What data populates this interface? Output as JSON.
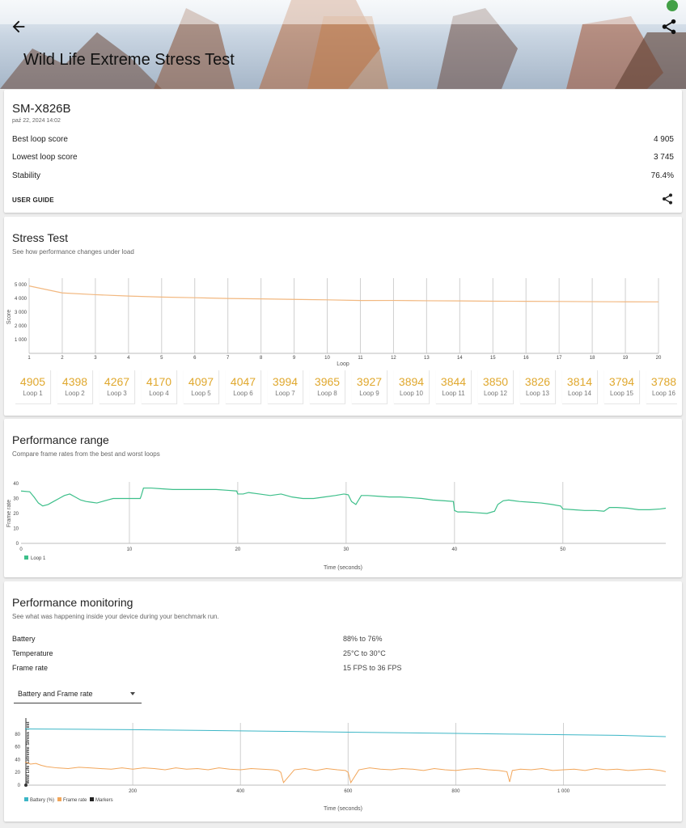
{
  "header": {
    "title": "Wild Life Extreme Stress Test"
  },
  "summary": {
    "device": "SM-X826B",
    "date": "paź 22, 2024 14:02",
    "rows": [
      {
        "label": "Best loop score",
        "value": "4 905"
      },
      {
        "label": "Lowest loop score",
        "value": "3 745"
      },
      {
        "label": "Stability",
        "value": "76.4%"
      }
    ],
    "user_guide": "USER GUIDE"
  },
  "stress": {
    "title": "Stress Test",
    "subtitle": "See how performance changes under load",
    "loops": [
      {
        "score": "4905",
        "label": "Loop 1"
      },
      {
        "score": "4398",
        "label": "Loop 2"
      },
      {
        "score": "4267",
        "label": "Loop 3"
      },
      {
        "score": "4170",
        "label": "Loop 4"
      },
      {
        "score": "4097",
        "label": "Loop 5"
      },
      {
        "score": "4047",
        "label": "Loop 6"
      },
      {
        "score": "3994",
        "label": "Loop 7"
      },
      {
        "score": "3965",
        "label": "Loop 8"
      },
      {
        "score": "3927",
        "label": "Loop 9"
      },
      {
        "score": "3894",
        "label": "Loop 10"
      },
      {
        "score": "3844",
        "label": "Loop 11"
      },
      {
        "score": "3850",
        "label": "Loop 12"
      },
      {
        "score": "3826",
        "label": "Loop 13"
      },
      {
        "score": "3814",
        "label": "Loop 14"
      },
      {
        "score": "3794",
        "label": "Loop 15"
      },
      {
        "score": "3788",
        "label": "Loop 16"
      }
    ]
  },
  "range": {
    "title": "Performance range",
    "subtitle": "Compare frame rates from the best and worst loops"
  },
  "monitor": {
    "title": "Performance monitoring",
    "subtitle": "See what was happening inside your device during your benchmark run.",
    "rows": [
      {
        "label": "Battery",
        "value": "88% to 76%"
      },
      {
        "label": "Temperature",
        "value": "25°C to 30°C"
      },
      {
        "label": "Frame rate",
        "value": "15 FPS to 36 FPS"
      }
    ],
    "select_value": "Battery and Frame rate"
  },
  "colors": {
    "score": "#e0a82e",
    "line": "#f2b880",
    "range": "#3dbf8a",
    "battery": "#3cb6c6",
    "framerate": "#f2a65a"
  },
  "chart_data": [
    {
      "type": "line",
      "xlabel": "Loop",
      "ylabel": "Score",
      "x": [
        1,
        2,
        3,
        4,
        5,
        6,
        7,
        8,
        9,
        10,
        11,
        12,
        13,
        14,
        15,
        16,
        17,
        18,
        19,
        20
      ],
      "x_ticks": [
        "1",
        "2",
        "3",
        "4",
        "5",
        "6",
        "7",
        "8",
        "9",
        "10",
        "11",
        "12",
        "13",
        "14",
        "15",
        "16",
        "17",
        "18",
        "19",
        "20"
      ],
      "series": [
        {
          "values": [
            4905,
            4398,
            4267,
            4170,
            4097,
            4047,
            3994,
            3965,
            3927,
            3894,
            3844,
            3850,
            3826,
            3814,
            3794,
            3788,
            3775,
            3762,
            3752,
            3745
          ]
        }
      ],
      "ylim": [
        0,
        5000
      ],
      "y_ticks": [
        "1 000",
        "2 000",
        "3 000",
        "4 000",
        "5 000"
      ],
      "y_tick_values": [
        1000,
        2000,
        3000,
        4000,
        5000
      ],
      "grid": "vertical"
    },
    {
      "type": "line",
      "xlabel": "Time (seconds)",
      "ylabel": "Frame rate",
      "xlim": [
        0,
        59.5
      ],
      "x_ticks": [
        "0",
        "10",
        "20",
        "30",
        "40",
        "50"
      ],
      "x_tick_values": [
        0,
        10,
        20,
        30,
        40,
        50
      ],
      "ylim": [
        0,
        40
      ],
      "y_ticks": [
        "0",
        "10",
        "20",
        "30",
        "40"
      ],
      "y_tick_values": [
        0,
        10,
        20,
        30,
        40
      ],
      "legend": "bottom-left",
      "series": [
        {
          "name": "Loop 1",
          "x": [
            0,
            0.8,
            1.2,
            1.6,
            2.0,
            2.5,
            3.0,
            3.5,
            4.0,
            4.5,
            5.0,
            5.5,
            6.0,
            6.5,
            7.0,
            7.5,
            8.0,
            8.5,
            9.0,
            10.0,
            11.0,
            11.1,
            11.3,
            12.0,
            13.0,
            14.0,
            15.0,
            16.0,
            17.0,
            18.0,
            19.0,
            19.9,
            20.0,
            20.5,
            21.0,
            22.0,
            23.0,
            24.0,
            25.0,
            26.0,
            27.0,
            28.0,
            29.0,
            29.8,
            30.2,
            30.5,
            30.9,
            31.4,
            32.0,
            33.0,
            34.0,
            35.0,
            36.0,
            37.0,
            38.0,
            39.0,
            39.9,
            40.0,
            40.3,
            41.0,
            42.0,
            43.0,
            43.7,
            44.0,
            44.5,
            45.0,
            46.0,
            47.0,
            48.0,
            49.0,
            49.8,
            50.0,
            51.0,
            52.0,
            53.0,
            53.8,
            54.3,
            55.0,
            56.0,
            57.0,
            58.0,
            59.0,
            59.5
          ],
          "values": [
            35,
            34.5,
            31,
            27,
            25,
            26,
            28,
            30,
            32,
            33,
            31,
            29,
            28,
            27.5,
            27,
            28,
            29,
            30,
            30,
            30,
            30,
            32,
            37,
            37,
            36.5,
            36,
            36,
            36,
            36,
            36,
            35.5,
            35,
            33,
            33,
            34,
            33,
            32,
            33,
            31,
            30,
            30,
            31,
            32,
            33,
            32.5,
            28,
            26,
            32,
            32,
            31.5,
            31,
            31,
            30.5,
            30,
            29,
            28.5,
            28,
            22,
            21,
            21,
            20.5,
            20,
            21.5,
            26,
            28.5,
            29,
            28,
            27.5,
            27,
            26,
            25,
            23,
            22.5,
            22,
            22,
            21.5,
            24,
            24,
            23.5,
            22.5,
            22.5,
            23,
            23.5
          ]
        }
      ]
    },
    {
      "type": "line",
      "xlabel": "Time (seconds)",
      "ylabel": "Wild Life Extreme Stress Test",
      "xlim": [
        0,
        1190
      ],
      "x_ticks": [
        "200",
        "400",
        "600",
        "800",
        "1 000"
      ],
      "x_tick_values": [
        200,
        400,
        600,
        800,
        1000
      ],
      "ylim": [
        0,
        95
      ],
      "y_ticks": [
        "0",
        "20",
        "40",
        "60",
        "80"
      ],
      "y_tick_values": [
        0,
        20,
        40,
        60,
        80
      ],
      "legend": "bottom-left",
      "series": [
        {
          "name": "Battery (%)",
          "x": [
            0,
            100,
            200,
            300,
            400,
            500,
            600,
            700,
            800,
            900,
            1000,
            1100,
            1190
          ],
          "values": [
            88,
            87.5,
            87,
            86,
            85,
            84,
            83,
            82,
            81,
            80,
            79,
            78,
            76
          ]
        },
        {
          "name": "Frame rate",
          "x": [
            0,
            5,
            10,
            20,
            30,
            40,
            60,
            80,
            100,
            120,
            140,
            160,
            180,
            200,
            220,
            240,
            260,
            280,
            300,
            320,
            340,
            360,
            380,
            400,
            420,
            440,
            460,
            470,
            475,
            480,
            500,
            520,
            540,
            560,
            580,
            595,
            600,
            605,
            620,
            640,
            660,
            680,
            700,
            720,
            740,
            760,
            780,
            800,
            820,
            840,
            860,
            880,
            895,
            900,
            905,
            920,
            940,
            960,
            980,
            1000,
            1020,
            1040,
            1060,
            1080,
            1100,
            1120,
            1140,
            1160,
            1180,
            1190
          ],
          "values": [
            36,
            35,
            33,
            34,
            31,
            29,
            27,
            26,
            28,
            27,
            26,
            25,
            27,
            25,
            27,
            26,
            24,
            27,
            25,
            26,
            24,
            27,
            25,
            24,
            26,
            25,
            24,
            23,
            20,
            4,
            24,
            26,
            23,
            26,
            24,
            23,
            20,
            4,
            24,
            27,
            25,
            24,
            26,
            25,
            23,
            26,
            24,
            23,
            25,
            26,
            24,
            23,
            21,
            5,
            23,
            25,
            24,
            26,
            23,
            24,
            25,
            23,
            26,
            24,
            25,
            23,
            24,
            25,
            23,
            21
          ]
        },
        {
          "name": "Markers",
          "x": [],
          "values": []
        }
      ]
    }
  ]
}
